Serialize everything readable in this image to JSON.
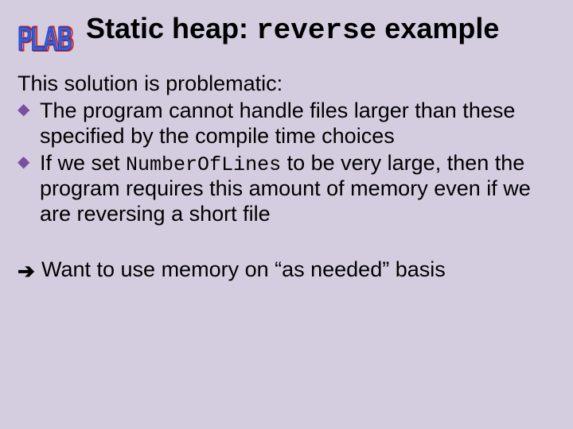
{
  "logo": {
    "text": "PLAB"
  },
  "title": {
    "lead": "Static heap: ",
    "code": "reverse",
    "tail": " example"
  },
  "intro": "This solution is problematic:",
  "bullets": [
    {
      "pre": "The program cannot handle files larger than these specified by the compile time choices",
      "code": "",
      "post": ""
    },
    {
      "pre": "If we set ",
      "code": "NumberOfLines",
      "post": " to be very large, then the program requires this amount of memory even if we are reversing a short file"
    }
  ],
  "conclusion": "Want to use memory on “as needed” basis"
}
